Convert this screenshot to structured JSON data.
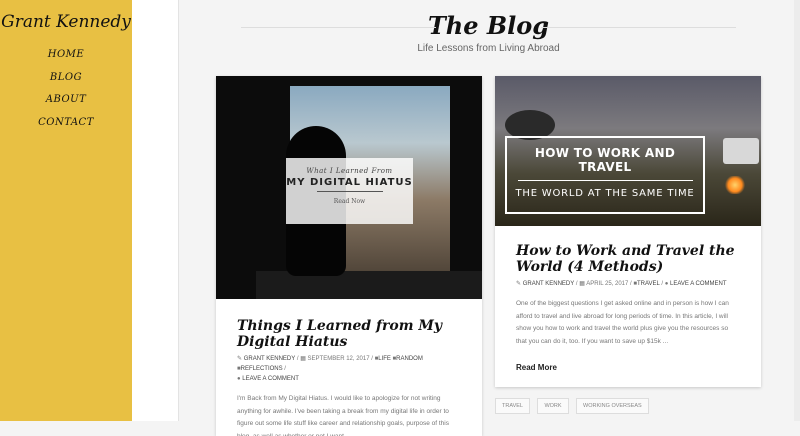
{
  "site": {
    "title": "Grant Kennedy"
  },
  "nav": [
    "HOME",
    "BLOG",
    "ABOUT",
    "CONTACT"
  ],
  "blog": {
    "title": "The Blog",
    "subtitle": "Life Lessons from Living Abroad"
  },
  "posts": [
    {
      "image_overlay": {
        "small": "What I Learned From",
        "big": "MY DIGITAL HIATUS",
        "read": "Read Now"
      },
      "title": "Things I Learned from My Digital Hiatus",
      "author": "GRANT KENNEDY",
      "date": "SEPTEMBER 12, 2017",
      "categories": [
        "LIFE",
        "RANDOM",
        "REFLECTIONS"
      ],
      "comment": "LEAVE A COMMENT",
      "excerpt": "I'm Back from My Digital Hiatus. I would like to apologize for not writing anything for awhile. I've been taking a break from my digital life in order to figure out some life stuff like career and relationship goals, purpose of this blog, as well as whether or not I want"
    },
    {
      "image_overlay": {
        "line1": "HOW TO WORK AND TRAVEL",
        "line2": "THE WORLD AT THE SAME TIME"
      },
      "title": "How to Work and Travel the World (4 Methods)",
      "author": "GRANT KENNEDY",
      "date": "APRIL 25, 2017",
      "categories": [
        "TRAVEL"
      ],
      "comment": "LEAVE A COMMENT",
      "excerpt": "One of the biggest questions I get asked online and in person is how I can afford to travel and live abroad for long periods of time. In this article, I will show you how to work and travel the world plus give you the resources so that you can do it, too. If you want to save up $15k ...",
      "read_more": "Read More"
    }
  ],
  "tags": [
    "TRAVEL",
    "WORK",
    "WORKING OVERSEAS"
  ]
}
